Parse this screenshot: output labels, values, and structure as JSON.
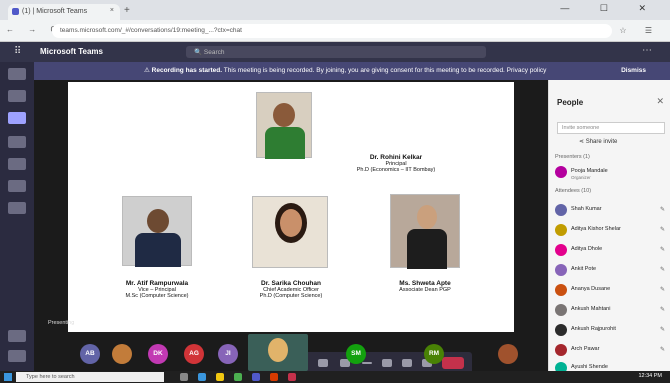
{
  "browser": {
    "tab_title": "(1) | Microsoft Teams",
    "tab_close": "×",
    "new_tab": "+",
    "nav_icons": "← → C",
    "url": "teams.microsoft.com/_#/conversations/19:meeting_...?ctx=chat",
    "addr_right": "☆ ☰",
    "win_controls": "— ☐ ✕"
  },
  "teams": {
    "app_grid_icon": "apps-grid-icon",
    "title": "Microsoft Teams",
    "search_placeholder": "Search",
    "more": "⋯"
  },
  "banner": {
    "bold": "Recording has started.",
    "text": " This meeting is being recorded. By joining, you are giving consent for this meeting to be recorded. Privacy policy",
    "dismiss": "Dismiss"
  },
  "slide": {
    "people": [
      {
        "name": "Dr. Rohini Kelkar",
        "role1": "Principal",
        "role2": "Ph.D (Economics – IIT Bombay)"
      },
      {
        "name": "Mr. Atif Rampurwala",
        "role1": "Vice – Principal",
        "role2": "M.Sc (Computer Science)"
      },
      {
        "name": "Dr. Sarika Chouhan",
        "role1": "Chief Academic Officer",
        "role2": "Ph.D (Computer Science)"
      },
      {
        "name": "Ms. Shweta Apte",
        "role1": "Associate Dean PGP",
        "role2": ""
      }
    ],
    "presenter_tag": "Presenting"
  },
  "controls": {
    "hangup_icon": "hang-up-icon"
  },
  "participants_strip": [
    {
      "initials": "AB",
      "color": "#6264a7"
    },
    {
      "initials": "",
      "color": "#c27c3a"
    },
    {
      "initials": "DK",
      "color": "#c239b3"
    },
    {
      "initials": "AG",
      "color": "#d13438"
    },
    {
      "initials": "JI",
      "color": "#8764b8"
    },
    {
      "initials": "SM",
      "color": "#13a10e"
    },
    {
      "initials": "RM",
      "color": "#498205"
    },
    {
      "initials": "",
      "color": "#a0522d"
    }
  ],
  "panel": {
    "title": "People",
    "close": "✕",
    "search_placeholder": "Invite someone",
    "share_invite": "Share invite",
    "presenters_label": "Presenters (1)",
    "attendees_label": "Attendees (10)",
    "presenters": [
      {
        "name": "Pooja Mandale",
        "sub": "Organizer",
        "color": "#b4009e"
      }
    ],
    "attendees": [
      {
        "name": "Shah Kumar",
        "color": "#6264a7"
      },
      {
        "name": "Aditya Kishor Shelar",
        "color": "#c19c00"
      },
      {
        "name": "Aditya Dhole",
        "color": "#e3008c"
      },
      {
        "name": "Ankit Pote",
        "color": "#8764b8"
      },
      {
        "name": "Ananya Dusane",
        "color": "#ca5010"
      },
      {
        "name": "Ankush Mahtani",
        "color": "#7a7574"
      },
      {
        "name": "Ankush Rajpurohit",
        "color": "#2b2b2b"
      },
      {
        "name": "Arch Pawar",
        "color": "#a4262c"
      },
      {
        "name": "Ayushi Shende",
        "color": "#00b294"
      }
    ]
  },
  "taskbar": {
    "search": "Type here to search",
    "clock": "12:34 PM"
  }
}
